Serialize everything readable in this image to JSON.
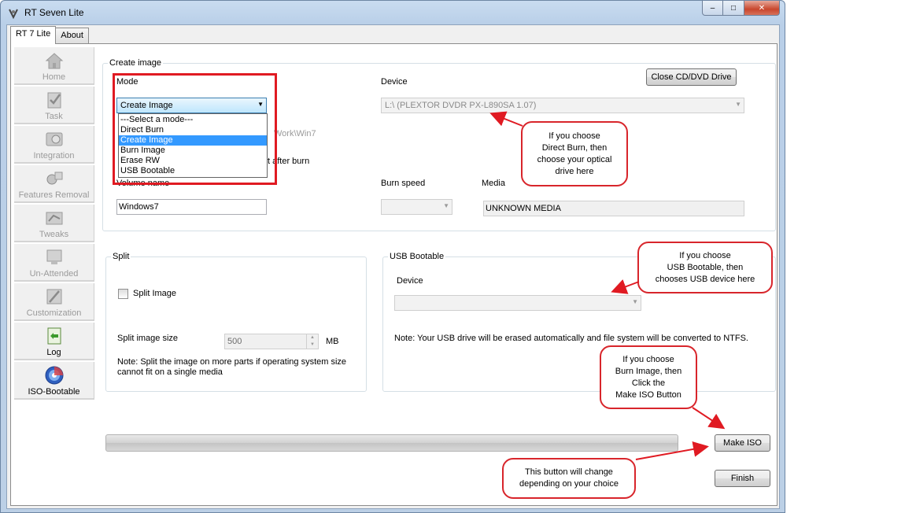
{
  "window": {
    "title": "RT Seven Lite",
    "controls": {
      "minimize": "–",
      "maximize": "□",
      "close": "✕"
    }
  },
  "tabs": [
    "RT 7 Lite",
    "About"
  ],
  "sidebar": {
    "items": [
      {
        "label": "Home",
        "icon": "home-icon"
      },
      {
        "label": "Task",
        "icon": "task-icon"
      },
      {
        "label": "Integration",
        "icon": "integration-icon"
      },
      {
        "label": "Features Removal",
        "icon": "features-removal-icon"
      },
      {
        "label": "Tweaks",
        "icon": "tweaks-icon"
      },
      {
        "label": "Un-Attended",
        "icon": "unattended-icon"
      },
      {
        "label": "Customization",
        "icon": "customization-icon"
      },
      {
        "label": "Log",
        "icon": "log-icon"
      },
      {
        "label": "ISO-Bootable",
        "icon": "iso-bootable-icon"
      }
    ]
  },
  "create_image": {
    "group_title": "Create image",
    "mode_label": "Mode",
    "mode_value": "Create Image",
    "mode_options": [
      "---Select a mode---",
      "Direct Burn",
      "Create Image",
      "Burn Image",
      "Erase RW",
      "USB Bootable"
    ],
    "mode_selected": "Create Image",
    "device_label": "Device",
    "device_value": "L:\\ (PLEXTOR  DVDR   PX-L890SA 1.07)",
    "close_drive_button": "Close CD/DVD Drive",
    "hidden_path_text": "Work\\Win7",
    "hidden_after_burn_text": "t after burn",
    "volume_name_label": "Volume name",
    "volume_name_value": "Windows7",
    "burn_speed_label": "Burn speed",
    "media_label": "Media",
    "media_value": "UNKNOWN MEDIA"
  },
  "split": {
    "group_title": "Split",
    "checkbox_label": "Split Image",
    "size_label": "Split image size",
    "size_value": "500",
    "unit": "MB",
    "note": "Note: Split the image on more parts if operating system size cannot fit on a single media"
  },
  "usb": {
    "group_title": "USB Bootable",
    "device_label": "Device",
    "note": "Note: Your USB drive will be erased automatically and file system will be converted to NTFS."
  },
  "buttons": {
    "make_iso": "Make ISO",
    "finish": "Finish"
  },
  "callouts": {
    "direct_burn": [
      "If you choose",
      "Direct Burn, then",
      "choose your optical",
      "drive here"
    ],
    "usb_bootable": [
      "If you choose",
      "USB Bootable, then",
      "chooses USB device here"
    ],
    "burn_image": [
      "If you choose",
      "Burn Image, then",
      "Click the",
      "Make ISO Button"
    ],
    "button_change": [
      "This button will change",
      "depending on your choice"
    ]
  },
  "colors": {
    "annotation_red": "#e01a22",
    "selection_blue": "#3399ff"
  }
}
